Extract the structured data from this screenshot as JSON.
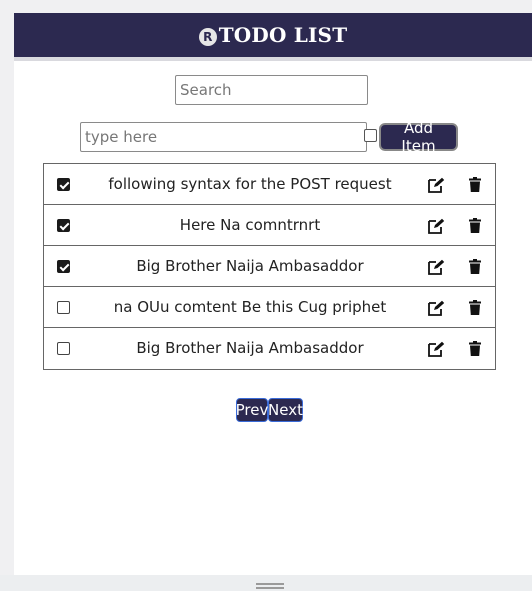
{
  "app": {
    "title": "TODO LIST",
    "logo_letter": "R"
  },
  "search": {
    "placeholder": "Search",
    "value": ""
  },
  "new_item": {
    "placeholder": "type here",
    "value": "",
    "checked": false
  },
  "add_button": {
    "label": "Add Item"
  },
  "todos": [
    {
      "text": "following syntax for the POST request",
      "done": true
    },
    {
      "text": "Here Na comntrnrt",
      "done": true
    },
    {
      "text": "Big Brother Naija Ambasaddor",
      "done": true
    },
    {
      "text": "na OUu comtent Be this Cug priphet",
      "done": false
    },
    {
      "text": "Big Brother Naija Ambasaddor",
      "done": false
    }
  ],
  "pagination": {
    "prev_label": "Prev",
    "next_label": "Next"
  },
  "icons": {
    "edit": "edit-icon",
    "delete": "trash-icon"
  },
  "colors": {
    "header_bg": "#2c2950",
    "button_bg": "#2c2950",
    "header_text": "#ffffff"
  }
}
